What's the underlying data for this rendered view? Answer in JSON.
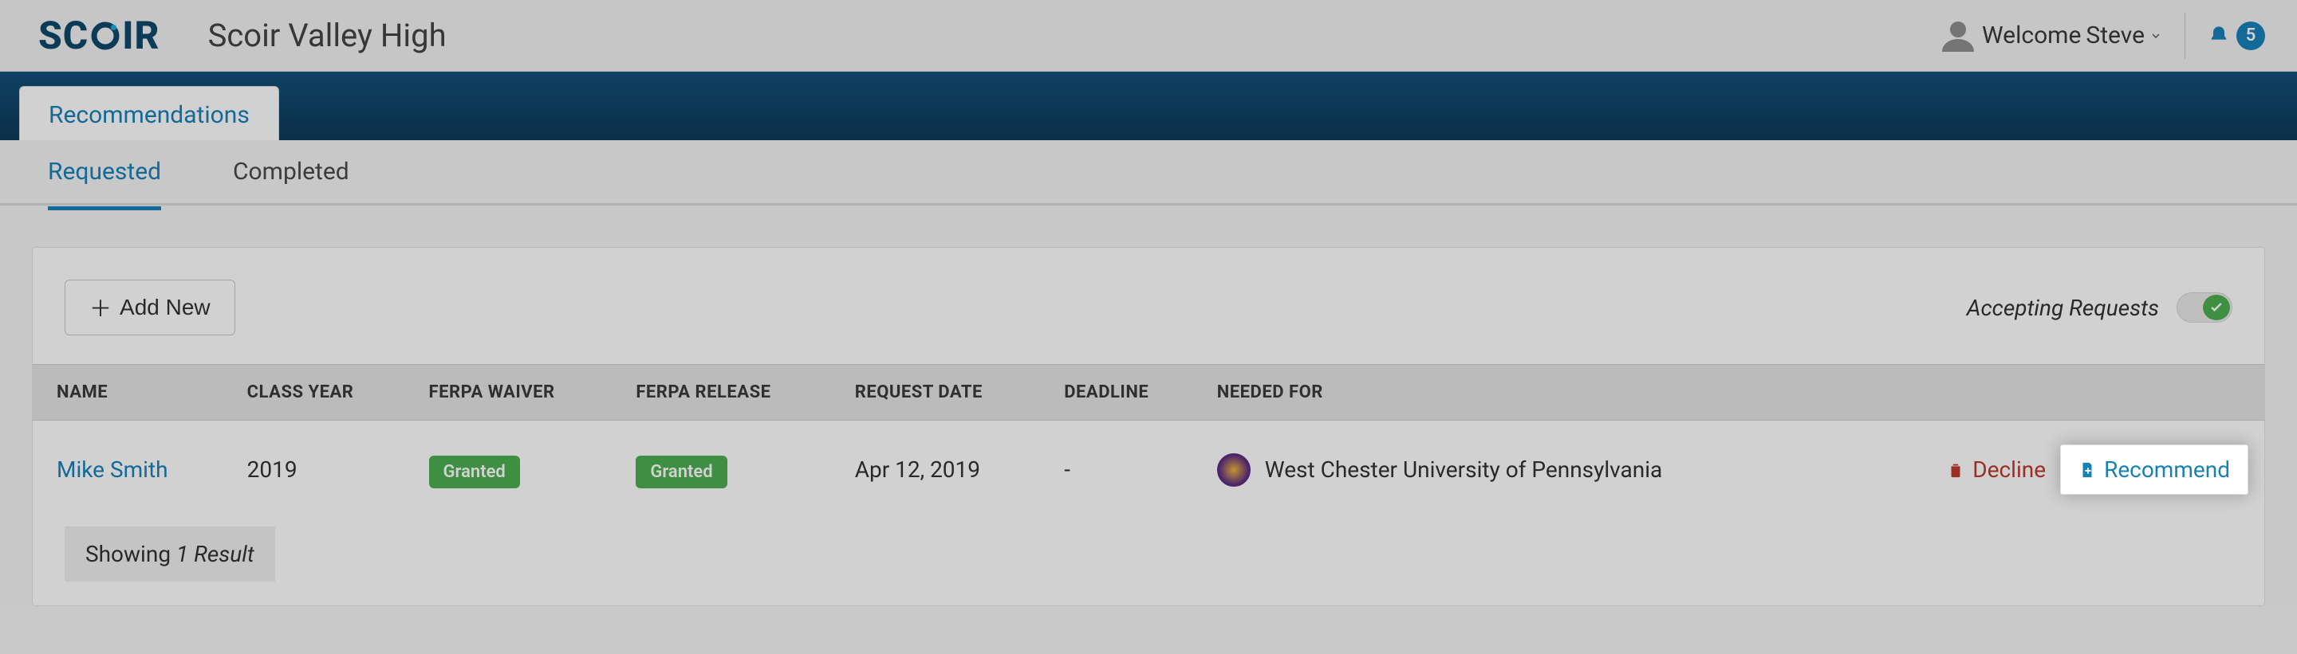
{
  "header": {
    "logo_text": "SCOIR",
    "school_name": "Scoir Valley High",
    "welcome_prefix": "Welcome",
    "user_name": "Steve",
    "notification_count": "5"
  },
  "nav": {
    "main_tab": "Recommendations",
    "subtabs": [
      {
        "label": "Requested",
        "active": true
      },
      {
        "label": "Completed",
        "active": false
      }
    ]
  },
  "panel": {
    "add_new_label": "Add New",
    "accepting_label": "Accepting Requests",
    "accepting_on": true
  },
  "table": {
    "columns": [
      "NAME",
      "CLASS YEAR",
      "FERPA WAIVER",
      "FERPA RELEASE",
      "REQUEST DATE",
      "DEADLINE",
      "NEEDED FOR"
    ],
    "rows": [
      {
        "name": "Mike Smith",
        "class_year": "2019",
        "ferpa_waiver": "Granted",
        "ferpa_release": "Granted",
        "request_date": "Apr 12, 2019",
        "deadline": "-",
        "needed_for": "West Chester University of Pennsylvania"
      }
    ],
    "actions": {
      "decline": "Decline",
      "recommend": "Recommend"
    },
    "footer_prefix": "Showing ",
    "footer_result": "1 Result"
  }
}
